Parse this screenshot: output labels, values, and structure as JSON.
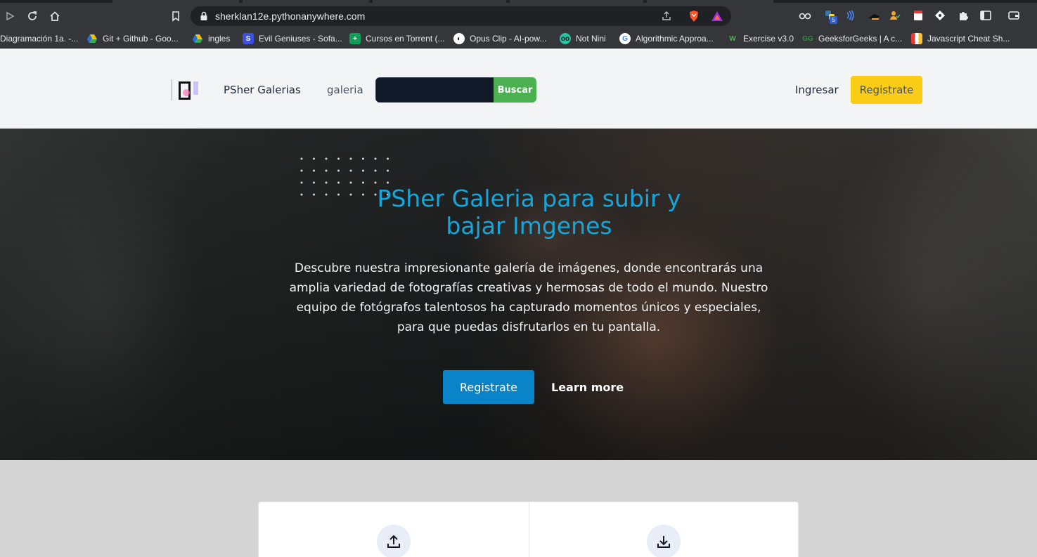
{
  "browser": {
    "url": "sherklan12e.pythonanywhere.com",
    "bookmarks": [
      {
        "label": "Diagramación 1a. -...",
        "icon": "doc-icon"
      },
      {
        "label": "Git + Github - Goo...",
        "icon": "google-drive-icon"
      },
      {
        "label": "ingles",
        "icon": "google-drive-icon"
      },
      {
        "label": "Evil Geniuses - Sofa...",
        "icon": "sofa-icon"
      },
      {
        "label": "Cursos en Torrent (...",
        "icon": "torrent-icon"
      },
      {
        "label": "Opus Clip - AI-pow...",
        "icon": "opus-icon"
      },
      {
        "label": "Not Nini",
        "icon": "nini-icon"
      },
      {
        "label": "Algorithmic Approa...",
        "icon": "google-icon"
      },
      {
        "label": "Exercise v3.0",
        "icon": "exercise-icon"
      },
      {
        "label": "GeeksforGeeks | A c...",
        "icon": "gfg-icon"
      },
      {
        "label": "Javascript Cheat Sh...",
        "icon": "cheatsheet-icon"
      }
    ],
    "extension_badge": "5"
  },
  "header": {
    "brand": "PSher Galerias",
    "nav_galeria": "galeria",
    "search_placeholder": "",
    "search_button": "Buscar",
    "login": "Ingresar",
    "register": "Registrate"
  },
  "hero": {
    "title_line1": "PSher Galeria para subir y",
    "title_line2": "bajar Imgenes",
    "description": "Descubre nuestra impresionante galería de imágenes, donde encontrarás una amplia variedad de fotografías creativas y hermosas de todo el mundo. Nuestro equipo de fotógrafos talentosos ha capturado momentos únicos y especiales, para que puedas disfrutarlos en tu pantalla.",
    "register_button": "Registrate",
    "learn_more": "Learn more"
  },
  "features": [
    {
      "icon": "upload-icon"
    },
    {
      "icon": "download-icon"
    }
  ],
  "colors": {
    "accent_title": "#16a6d9",
    "register_yellow": "#facc15",
    "search_green": "#4caf50",
    "hero_button_blue": "#0a84c8"
  }
}
